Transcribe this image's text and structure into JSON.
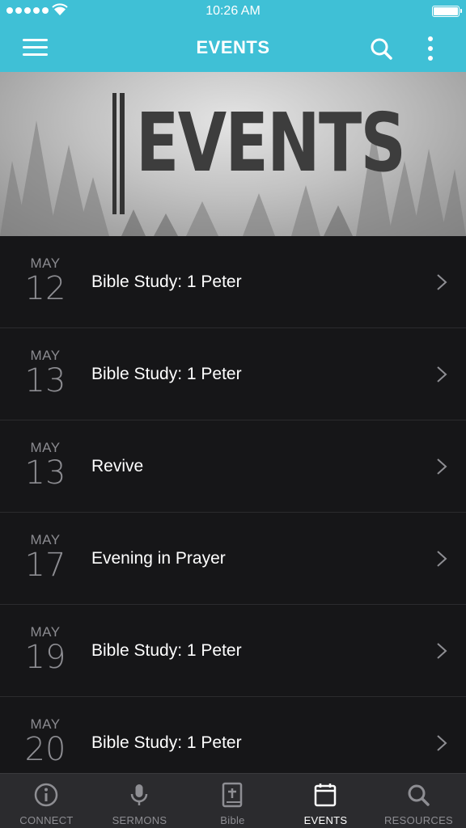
{
  "status_bar": {
    "time": "10:26 AM"
  },
  "nav": {
    "title": "EVENTS",
    "menu_icon": "hamburger-menu-icon",
    "search_icon": "search-icon",
    "more_icon": "more-vertical-icon"
  },
  "hero": {
    "text": "EVENTS"
  },
  "events": [
    {
      "month": "MAY",
      "day": "12",
      "title": "Bible Study: 1 Peter"
    },
    {
      "month": "MAY",
      "day": "13",
      "title": "Bible Study: 1 Peter"
    },
    {
      "month": "MAY",
      "day": "13",
      "title": "Revive"
    },
    {
      "month": "MAY",
      "day": "17",
      "title": "Evening in Prayer"
    },
    {
      "month": "MAY",
      "day": "19",
      "title": "Bible Study: 1 Peter"
    },
    {
      "month": "MAY",
      "day": "20",
      "title": "Bible Study: 1 Peter"
    }
  ],
  "tabs": [
    {
      "label": "CONNECT",
      "icon": "info-circle-icon",
      "active": false
    },
    {
      "label": "SERMONS",
      "icon": "microphone-icon",
      "active": false
    },
    {
      "label": "Bible",
      "icon": "bible-icon",
      "active": false
    },
    {
      "label": "EVENTS",
      "icon": "calendar-icon",
      "active": true
    },
    {
      "label": "RESOURCES",
      "icon": "search-icon",
      "active": false
    }
  ],
  "colors": {
    "accent": "#3fc0d6",
    "background": "#161618",
    "tabbar": "#2b2b2e"
  }
}
